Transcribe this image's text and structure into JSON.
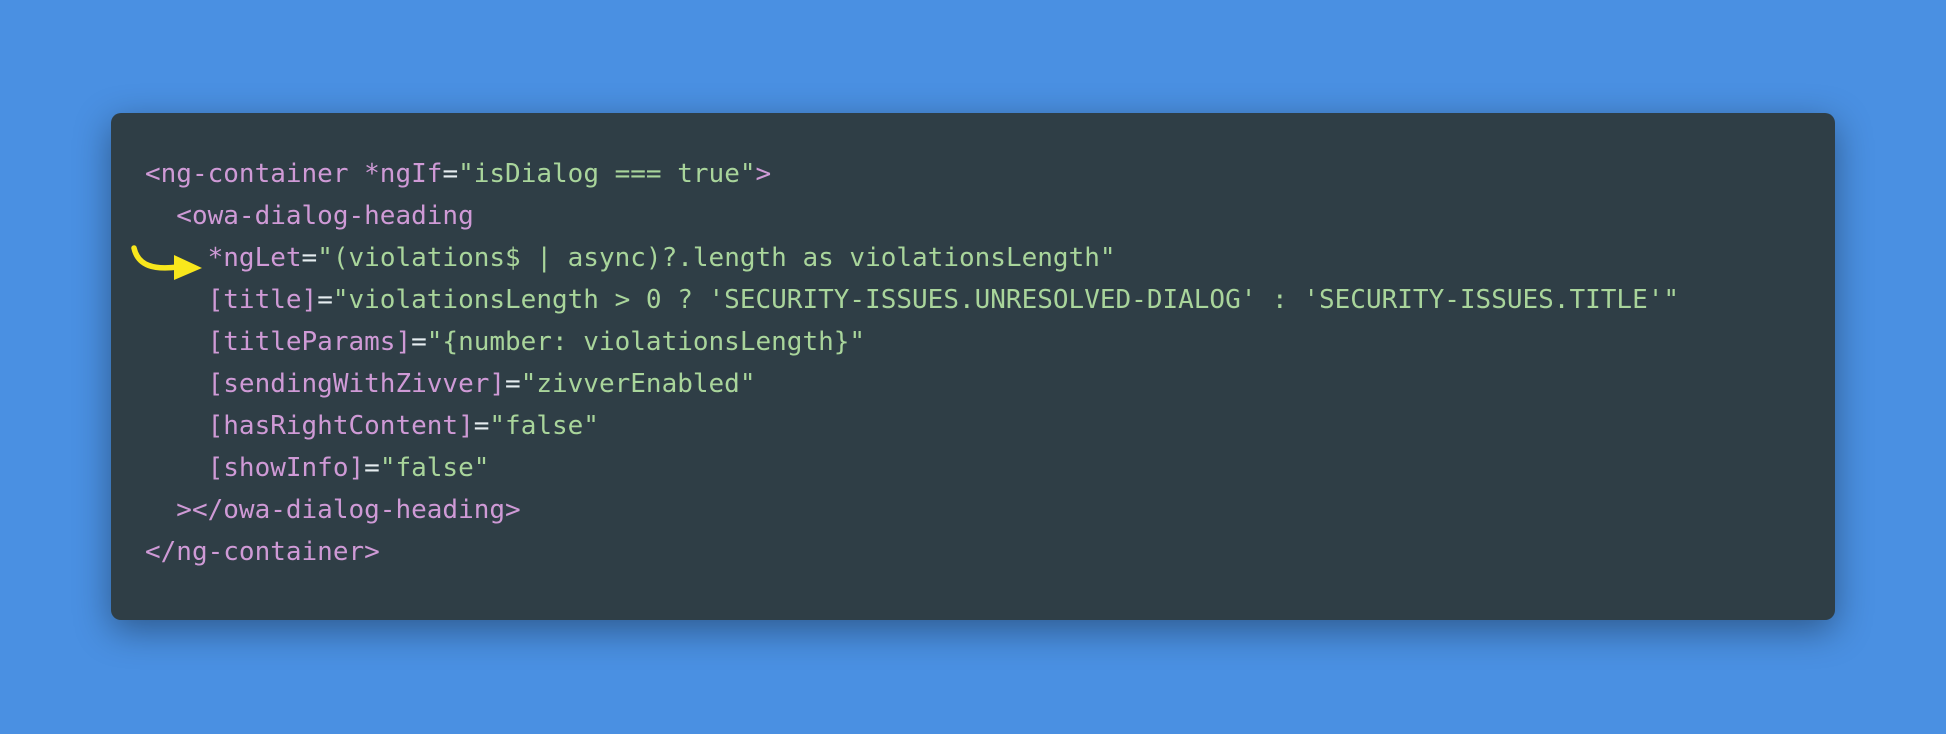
{
  "colors": {
    "background": "#4a90e2",
    "panel": "#2f3e46",
    "tag": "#cf9ad6",
    "string": "#a9d59b",
    "operator": "#e6edf0",
    "arrow": "#f8e71c"
  },
  "annotation": {
    "icon": "curved-arrow-icon",
    "points_to_line": 3
  },
  "code": {
    "lines": [
      [
        {
          "t": "<ng-container ",
          "c": "tok-tag"
        },
        {
          "t": "*ngIf",
          "c": "tok-attr"
        },
        {
          "t": "=",
          "c": "tok-op"
        },
        {
          "t": "\"isDialog === true\"",
          "c": "tok-str"
        },
        {
          "t": ">",
          "c": "tok-tag"
        }
      ],
      [
        {
          "t": "  <owa-dialog-heading",
          "c": "tok-tag"
        }
      ],
      [
        {
          "t": "    *ngLet",
          "c": "tok-attr"
        },
        {
          "t": "=",
          "c": "tok-op"
        },
        {
          "t": "\"(violations$ | async)?.length as violationsLength\"",
          "c": "tok-str"
        }
      ],
      [
        {
          "t": "    [title]",
          "c": "tok-attr"
        },
        {
          "t": "=",
          "c": "tok-op"
        },
        {
          "t": "\"violationsLength > 0 ? 'SECURITY-ISSUES.UNRESOLVED-DIALOG' : 'SECURITY-ISSUES.TITLE'\"",
          "c": "tok-str"
        }
      ],
      [
        {
          "t": "    [titleParams]",
          "c": "tok-attr"
        },
        {
          "t": "=",
          "c": "tok-op"
        },
        {
          "t": "\"{number: violationsLength}\"",
          "c": "tok-str"
        }
      ],
      [
        {
          "t": "    [sendingWithZivver]",
          "c": "tok-attr"
        },
        {
          "t": "=",
          "c": "tok-op"
        },
        {
          "t": "\"zivverEnabled\"",
          "c": "tok-str"
        }
      ],
      [
        {
          "t": "    [hasRightContent]",
          "c": "tok-attr"
        },
        {
          "t": "=",
          "c": "tok-op"
        },
        {
          "t": "\"false\"",
          "c": "tok-str"
        }
      ],
      [
        {
          "t": "    [showInfo]",
          "c": "tok-attr"
        },
        {
          "t": "=",
          "c": "tok-op"
        },
        {
          "t": "\"false\"",
          "c": "tok-str"
        }
      ],
      [
        {
          "t": "  ></owa-dialog-heading>",
          "c": "tok-tag"
        }
      ],
      [
        {
          "t": "</ng-container>",
          "c": "tok-tag"
        }
      ]
    ]
  }
}
